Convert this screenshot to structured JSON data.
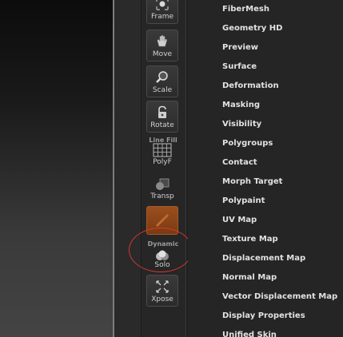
{
  "toolbar": {
    "frame": "Frame",
    "move": "Move",
    "scale": "Scale",
    "rotate": "Rotate",
    "line_fill_caption": "Line Fill",
    "polyf": "PolyF",
    "transp": "Transp",
    "dynamic_caption": "Dynamic",
    "solo": "Solo",
    "xpose": "Xpose"
  },
  "menu": {
    "items": [
      "FiberMesh",
      "Geometry HD",
      "Preview",
      "Surface",
      "Deformation",
      "Masking",
      "Visibility",
      "Polygroups",
      "Contact",
      "Morph Target",
      "Polypaint",
      "UV Map",
      "Texture Map",
      "Displacement Map",
      "Normal Map",
      "Vector Displacement Map",
      "Display Properties",
      "Unified Skin"
    ]
  },
  "colors": {
    "highlight_circle": "#d8362e",
    "active_tool": "#9a4f1e"
  },
  "icons": [
    "frame-icon",
    "move-hand-icon",
    "scale-magnifier-icon",
    "rotate-lock-icon",
    "polyframe-grid-icon",
    "transp-icon",
    "solo-icon",
    "xpose-arrows-icon"
  ]
}
